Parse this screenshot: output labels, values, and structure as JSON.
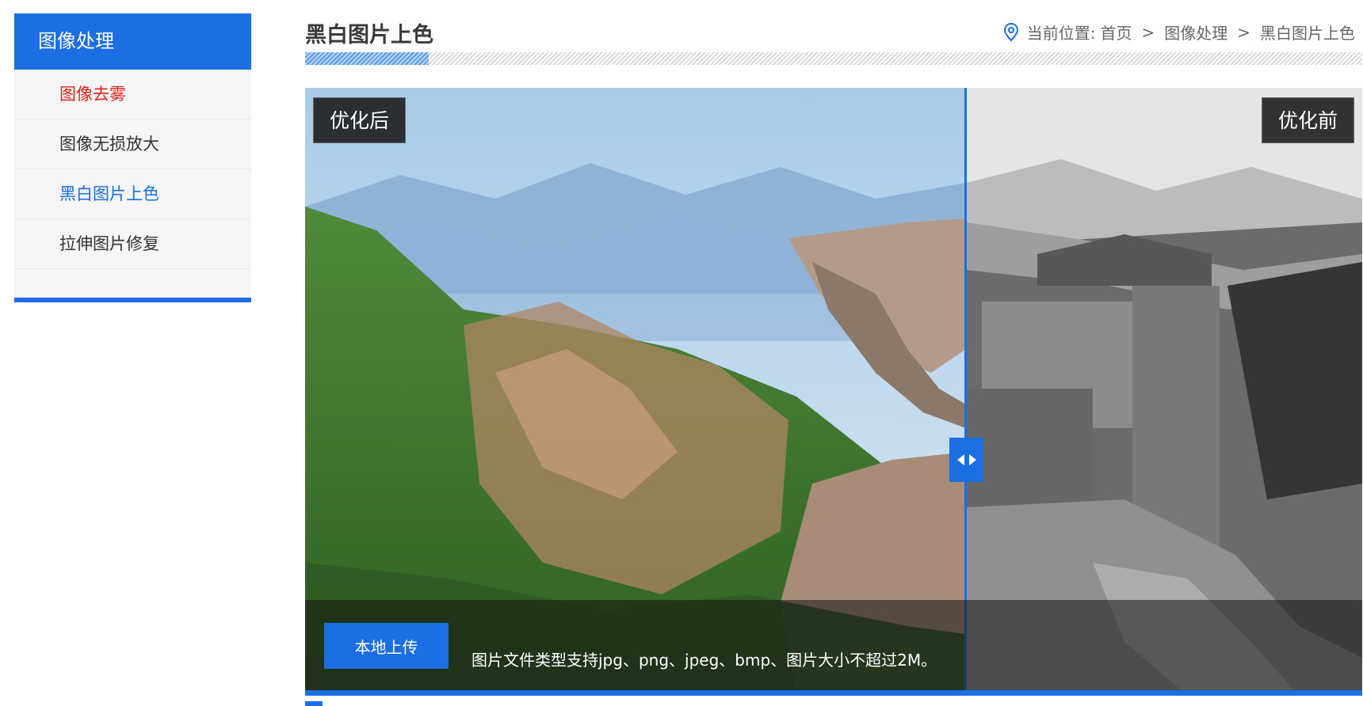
{
  "sidebar": {
    "title": "图像处理",
    "items": [
      {
        "label": "图像去雾",
        "state": "highlight"
      },
      {
        "label": "图像无损放大",
        "state": "normal"
      },
      {
        "label": "黑白图片上色",
        "state": "active"
      },
      {
        "label": "拉伸图片修复",
        "state": "normal"
      }
    ]
  },
  "header": {
    "title": "黑白图片上色",
    "breadcrumb": {
      "prefix": "当前位置:",
      "items": [
        "首页",
        "图像处理",
        "黑白图片上色"
      ],
      "separator": ">"
    }
  },
  "viewer": {
    "after_label": "优化后",
    "before_label": "优化前",
    "upload_label": "本地上传",
    "hint": "图片文件类型支持jpg、png、jpeg、bmp、图片大小不超过2M。"
  },
  "colors": {
    "accent": "#1b6ee3",
    "highlight": "#e3231b"
  },
  "icons": [
    "location-pin-icon",
    "arrow-left-icon",
    "arrow-right-icon"
  ]
}
